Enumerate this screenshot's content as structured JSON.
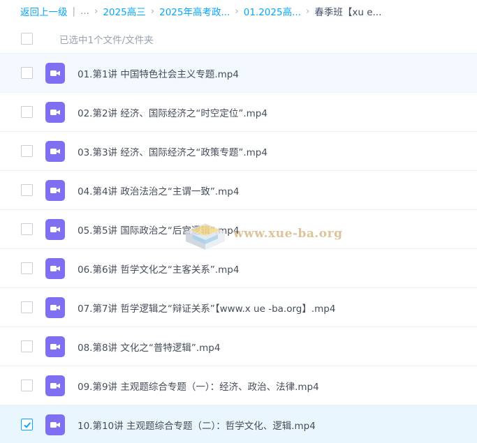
{
  "breadcrumb": {
    "back": "返回上一级",
    "ellipsis": "...",
    "items": [
      "2025高三",
      "2025年高考政...",
      "01.2025高..."
    ],
    "current": "春季班【xu e..."
  },
  "selection": {
    "label": "已选中1个文件/文件夹"
  },
  "files": [
    {
      "name": "01.第1讲 中国特色社会主义专题.mp4",
      "checked": false,
      "icon": "video-icon"
    },
    {
      "name": "02.第2讲 经济、国际经济之“时空定位”.mp4",
      "checked": false,
      "icon": "video-icon"
    },
    {
      "name": "03.第3讲 经济、国际经济之“政策专题”.mp4",
      "checked": false,
      "icon": "video-icon"
    },
    {
      "name": "04.第4讲 政治法治之“主谓一致”.mp4",
      "checked": false,
      "icon": "video-icon"
    },
    {
      "name": "05.第5讲 国际政治之“后宫逻辑”.mp4",
      "checked": false,
      "icon": "video-icon"
    },
    {
      "name": "06.第6讲 哲学文化之“主客关系”.mp4",
      "checked": false,
      "icon": "video-icon"
    },
    {
      "name": "07.第7讲 哲学逻辑之“辩证关系”【www.x ue -ba.org】.mp4",
      "checked": false,
      "icon": "video-icon"
    },
    {
      "name": "08.第8讲 文化之“普特逻辑”.mp4",
      "checked": false,
      "icon": "video-icon"
    },
    {
      "name": "09.第9讲 主观题综合专题（一）：经济、政治、法律.mp4",
      "checked": false,
      "icon": "video-icon"
    },
    {
      "name": "10.第10讲 主观题综合专题（二）：哲学文化、逻辑.mp4",
      "checked": true,
      "icon": "video-icon"
    }
  ],
  "watermark": {
    "text": "www.xue-ba.org"
  },
  "colors": {
    "accent": "#06a7ff",
    "video_icon": "#7f6ff2",
    "selected_row": "#eaf6fe"
  }
}
